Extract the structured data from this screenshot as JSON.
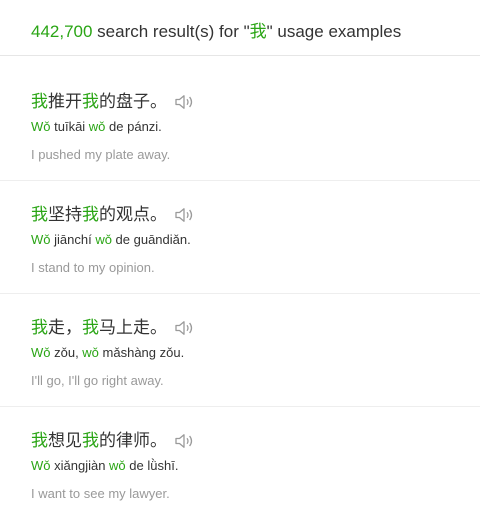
{
  "header": {
    "count": "442,700",
    "text_before": " search result(s) for \"",
    "term": "我",
    "text_after": "\" usage examples"
  },
  "colors": {
    "highlight": "#2aa515",
    "translation": "#999999",
    "divider": "#eeeeee"
  },
  "results": [
    {
      "cn": [
        "我",
        "推开",
        "我",
        "的盘子。"
      ],
      "pinyin": [
        "Wǒ",
        " tuīkāi ",
        "wǒ",
        " de pánzi."
      ],
      "en": "I pushed my plate away.",
      "icon": "speaker-icon"
    },
    {
      "cn": [
        "我",
        "坚持",
        "我",
        "的观点。"
      ],
      "pinyin": [
        "Wǒ",
        " jiānchí ",
        "wǒ",
        " de guāndiǎn."
      ],
      "en": "I stand to my opinion.",
      "icon": "speaker-icon"
    },
    {
      "cn": [
        "我",
        "走，",
        "我",
        "马上走。"
      ],
      "pinyin": [
        "Wǒ",
        " zǒu, ",
        "wǒ",
        " mǎshàng zǒu."
      ],
      "en": "I'll go, I'll go right away.",
      "icon": "speaker-icon"
    },
    {
      "cn": [
        "我",
        "想见",
        "我",
        "的律师。"
      ],
      "pinyin": [
        "Wǒ",
        " xiǎngjiàn ",
        "wǒ",
        " de lǜshī."
      ],
      "en": "I want to see my lawyer.",
      "icon": "speaker-icon"
    }
  ]
}
